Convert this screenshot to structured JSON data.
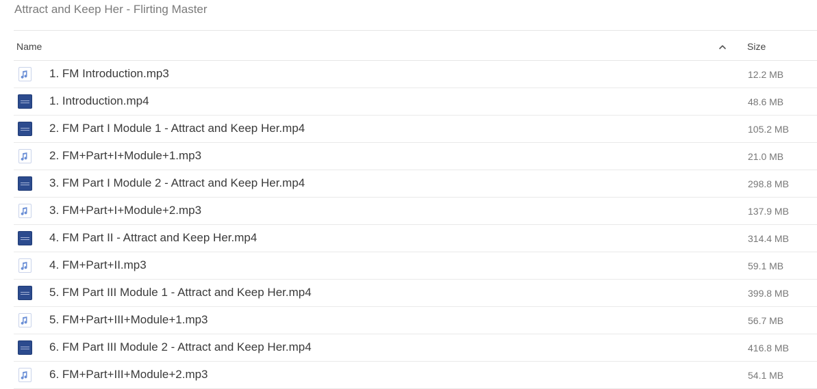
{
  "breadcrumb": "Attract and Keep Her - Flirting Master",
  "header": {
    "name_label": "Name",
    "size_label": "Size",
    "sort_icon": "chevron-up-icon"
  },
  "colors": {
    "audio_icon": "#6b8fd6",
    "video_thumb": "#2c4b8e"
  },
  "files": [
    {
      "name": "1. FM Introduction.mp3",
      "size": "12.2 MB",
      "type": "audio"
    },
    {
      "name": "1. Introduction.mp4",
      "size": "48.6 MB",
      "type": "video"
    },
    {
      "name": "2. FM Part I Module 1 - Attract and Keep Her.mp4",
      "size": "105.2 MB",
      "type": "video"
    },
    {
      "name": "2. FM+Part+I+Module+1.mp3",
      "size": "21.0 MB",
      "type": "audio"
    },
    {
      "name": "3. FM Part I Module 2 - Attract and Keep Her.mp4",
      "size": "298.8 MB",
      "type": "video"
    },
    {
      "name": "3. FM+Part+I+Module+2.mp3",
      "size": "137.9 MB",
      "type": "audio"
    },
    {
      "name": "4. FM Part II - Attract and Keep Her.mp4",
      "size": "314.4 MB",
      "type": "video"
    },
    {
      "name": "4. FM+Part+II.mp3",
      "size": "59.1 MB",
      "type": "audio"
    },
    {
      "name": "5. FM Part III Module 1 - Attract and Keep Her.mp4",
      "size": "399.8 MB",
      "type": "video"
    },
    {
      "name": "5. FM+Part+III+Module+1.mp3",
      "size": "56.7 MB",
      "type": "audio"
    },
    {
      "name": "6. FM Part III Module 2 - Attract and Keep Her.mp4",
      "size": "416.8 MB",
      "type": "video"
    },
    {
      "name": "6. FM+Part+III+Module+2.mp3",
      "size": "54.1 MB",
      "type": "audio"
    }
  ]
}
